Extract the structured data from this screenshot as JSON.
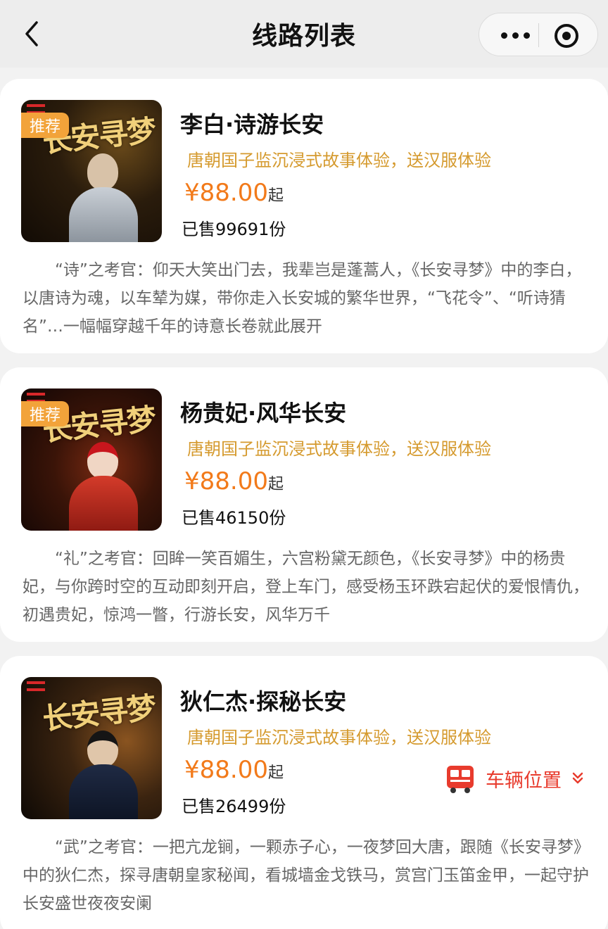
{
  "nav": {
    "title": "线路列表"
  },
  "routes": [
    {
      "tag": "推荐",
      "thumb_title": "长安寻梦",
      "name": "李白·诗游长安",
      "subtitle": "唐朝国子监沉浸式故事体验，送汉服体验",
      "price": "¥88.00",
      "price_suffix": "起",
      "sold": "已售99691份",
      "desc": "“诗”之考官：仰天大笑出门去，我辈岂是蓬蒿人，《长安寻梦》中的李白，以唐诗为魂，以车辇为媒，带你走入长安城的繁华世界，“飞花令”、“听诗猜名”…一幅幅穿越千年的诗意长卷就此展开"
    },
    {
      "tag": "推荐",
      "thumb_title": "长安寻梦",
      "name": "杨贵妃·风华长安",
      "subtitle": "唐朝国子监沉浸式故事体验，送汉服体验",
      "price": "¥88.00",
      "price_suffix": "起",
      "sold": "已售46150份",
      "desc": "“礼”之考官：回眸一笑百媚生，六宫粉黛无颜色，《长安寻梦》中的杨贵妃，与你跨时空的互动即刻开启，登上车门，感受杨玉环跌宕起伏的爱恨情仇，初遇贵妃，惊鸿一瞥，行游长安，风华万千"
    },
    {
      "thumb_title": "长安寻梦",
      "name": "狄仁杰·探秘长安",
      "subtitle": "唐朝国子监沉浸式故事体验，送汉服体验",
      "price": "¥88.00",
      "price_suffix": "起",
      "sold": "已售26499份",
      "vehicle_label": "车辆位置",
      "desc": "“武”之考官：一把亢龙锏，一颗赤子心，一夜梦回大唐，跟随《长安寻梦》中的狄仁杰，探寻唐朝皇家秘闻，看城墙金戈铁马，赏宫门玉笛金甲，一起守护长安盛世夜夜安阑"
    }
  ],
  "colors": {
    "accent_orange": "#f27a1a",
    "subtitle_gold": "#d59a2e",
    "vehicle_red": "#e83b2d",
    "tag_bg": "#f2a33a"
  },
  "icons": [
    "back-arrow-icon",
    "more-dots-icon",
    "close-circle-icon",
    "bus-icon",
    "double-chevron-down-icon"
  ]
}
